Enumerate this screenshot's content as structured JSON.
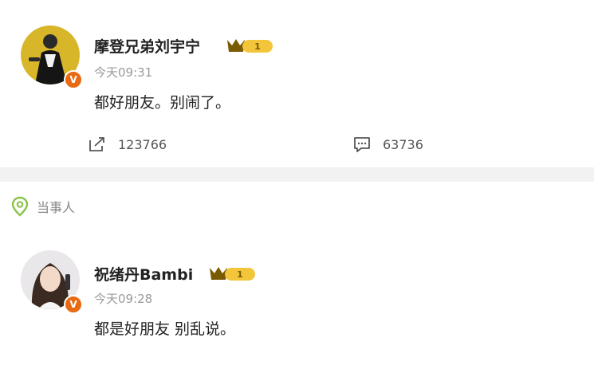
{
  "post1": {
    "username": "摩登兄弟刘宇宁",
    "time": "今天09:31",
    "content": "都好朋友。别闹了。",
    "repost_count": "123766",
    "comment_count": "63736",
    "verified_mark": "V",
    "level_mark": "1"
  },
  "section": {
    "tag_label": "当事人"
  },
  "post2": {
    "username": "祝绪丹Bambi",
    "time": "今天09:28",
    "content": "都是好朋友 别乱说。",
    "verified_mark": "V",
    "level_mark": "1"
  },
  "colors": {
    "verified_badge": "#e86a12",
    "level_badge": "#f3c53a",
    "crown": "#7a5a00",
    "location_icon": "#8bc34a",
    "divider": "#f2f2f2"
  },
  "icons": {
    "repost": "repost-icon",
    "comment": "comment-icon",
    "location": "location-pin-icon",
    "crown": "crown-icon"
  }
}
